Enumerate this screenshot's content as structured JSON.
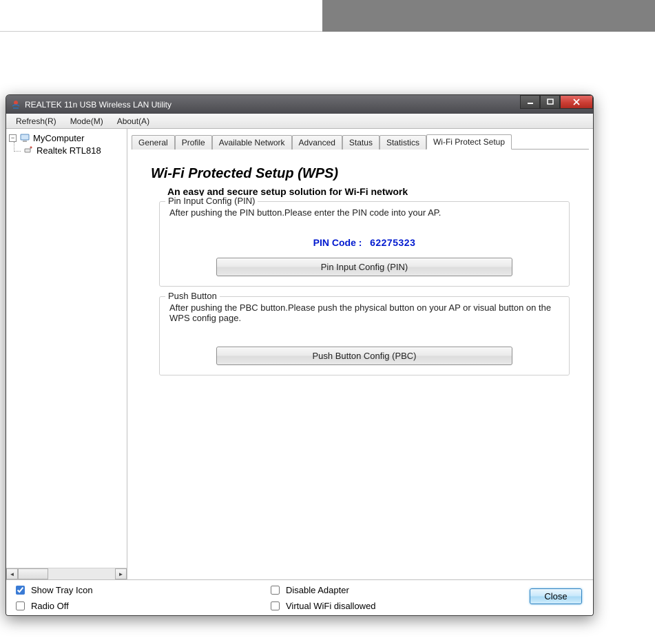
{
  "titlebar": {
    "title": "REALTEK 11n USB Wireless LAN Utility"
  },
  "menubar": {
    "items": [
      {
        "label": "Refresh(R)"
      },
      {
        "label": "Mode(M)"
      },
      {
        "label": "About(A)"
      }
    ]
  },
  "tree": {
    "root": "MyComputer",
    "child": "Realtek RTL818"
  },
  "tabs": {
    "items": [
      {
        "label": "General"
      },
      {
        "label": "Profile"
      },
      {
        "label": "Available Network"
      },
      {
        "label": "Advanced"
      },
      {
        "label": "Status"
      },
      {
        "label": "Statistics"
      },
      {
        "label": "Wi-Fi Protect Setup"
      }
    ],
    "active_index": 6
  },
  "wps": {
    "title": "Wi-Fi Protected Setup (WPS)",
    "subtitle": "An easy and secure setup solution for Wi-Fi network",
    "pin_group": {
      "title": "Pin Input Config (PIN)",
      "desc": "After pushing the PIN button.Please enter the PIN code into your AP.",
      "pin_label": "PIN Code :",
      "pin_value": "62275323",
      "button": "Pin Input Config (PIN)"
    },
    "pbc_group": {
      "title": "Push Button",
      "desc": "After pushing the PBC button.Please push the physical button on your AP or visual button on the WPS config page.",
      "button": "Push Button Config (PBC)"
    }
  },
  "bottom": {
    "show_tray": {
      "label": "Show Tray Icon",
      "checked": true
    },
    "radio_off": {
      "label": "Radio Off",
      "checked": false
    },
    "disable_adapter": {
      "label": "Disable Adapter",
      "checked": false
    },
    "virtual_wifi": {
      "label": "Virtual WiFi disallowed",
      "checked": false
    },
    "close": "Close"
  }
}
